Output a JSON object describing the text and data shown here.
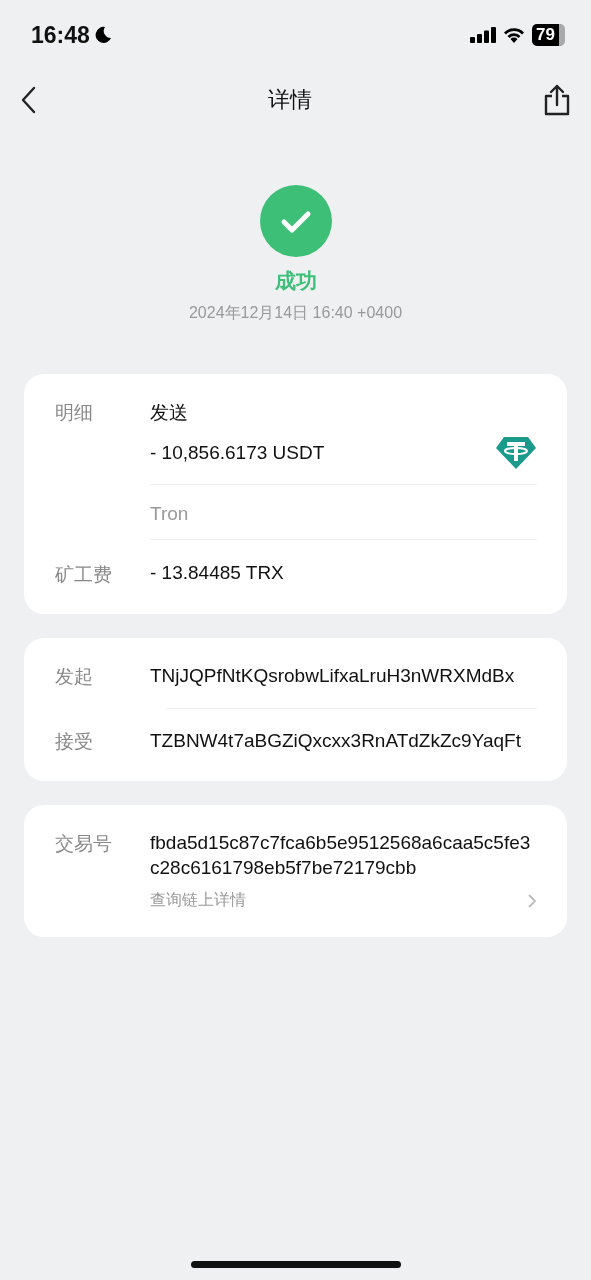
{
  "status_bar": {
    "time": "16:48",
    "battery": "79"
  },
  "nav": {
    "title": "详情"
  },
  "result": {
    "kind": "success",
    "label": "成功",
    "datetime": "2024年12月14日 16:40 +0400"
  },
  "summary": {
    "label": "明细",
    "direction": "发送",
    "amount": "- 10,856.6173 USDT",
    "network": "Tron",
    "fee_label": "矿工费",
    "fee": "- 13.84485 TRX"
  },
  "parties": [
    {
      "label": "发起",
      "address": "TNjJQPfNtKQsrobwLifxaLruH3nWRXMdBx"
    },
    {
      "label": "接受",
      "address": "TZBNW4t7aBGZiQxcxx3RnATdZkZc9YaqFt"
    }
  ],
  "transaction": {
    "label": "交易号",
    "hash": "fbda5d15c87c7fca6b5e9512568a6caa5c5fe3c28c6161798eb5f7be72179cbb",
    "link": "查询链上详情"
  }
}
